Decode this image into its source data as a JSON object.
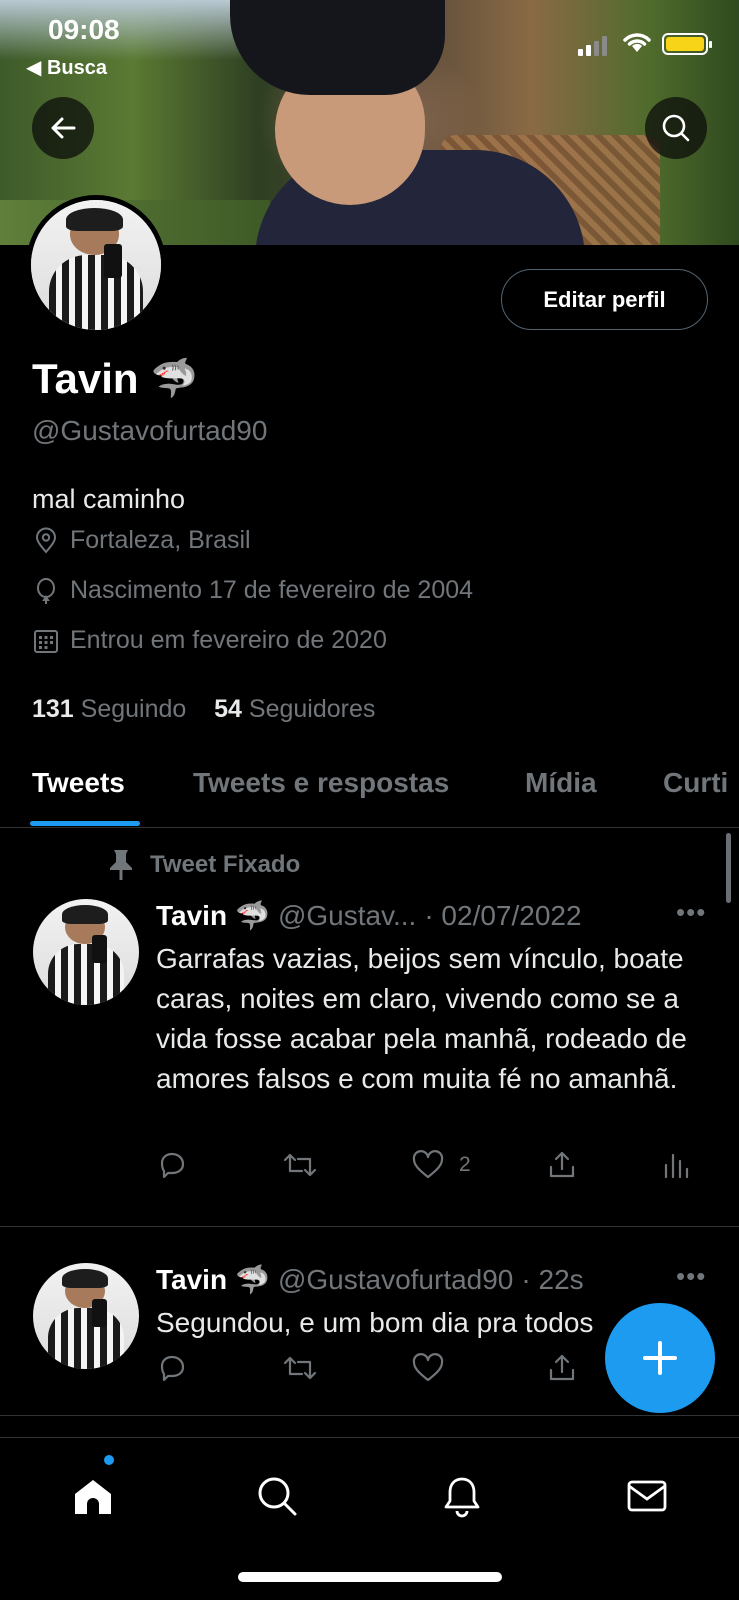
{
  "status_bar": {
    "time": "09:08",
    "back_app": "◀ Busca"
  },
  "profile": {
    "name": "Tavin",
    "name_emoji": "🦈",
    "handle": "@Gustavofurtad90",
    "edit_button": "Editar perfil",
    "bio": "mal caminho",
    "location": "Fortaleza, Brasil",
    "birth": "Nascimento 17 de fevereiro de 2004",
    "joined": "Entrou em fevereiro de 2020",
    "following_count": "131",
    "following_label": "Seguindo",
    "followers_count": "54",
    "followers_label": "Seguidores"
  },
  "tabs": [
    {
      "label": "Tweets",
      "active": true
    },
    {
      "label": "Tweets e respostas",
      "active": false
    },
    {
      "label": "Mídia",
      "active": false
    },
    {
      "label": "Curti",
      "active": false
    }
  ],
  "pinned_label": "Tweet Fixado",
  "tweets": [
    {
      "name": "Tavin",
      "emoji": "🦈",
      "handle": "@Gustav...",
      "time": "· 02/07/2022",
      "text": "Garrafas vazias, beijos sem vínculo, boate caras, noites em claro, vivendo como se a vida fosse acabar pela manhã, rodeado de amores falsos e com muita fé no amanhã.",
      "likes": "2"
    },
    {
      "name": "Tavin",
      "emoji": "🦈",
      "handle": "@Gustavofurtad90",
      "time": "· 22s",
      "text": "Segundou, e um bom dia pra todos",
      "likes": ""
    }
  ],
  "icons": {
    "back": "arrow-left-icon",
    "search": "search-icon",
    "compose": "plus-icon",
    "nav": [
      "home-icon",
      "search-icon",
      "bell-icon",
      "mail-icon"
    ]
  },
  "colors": {
    "accent": "#1d9bf0",
    "muted": "#71767b",
    "background": "#000000",
    "battery": "#f7d417"
  }
}
